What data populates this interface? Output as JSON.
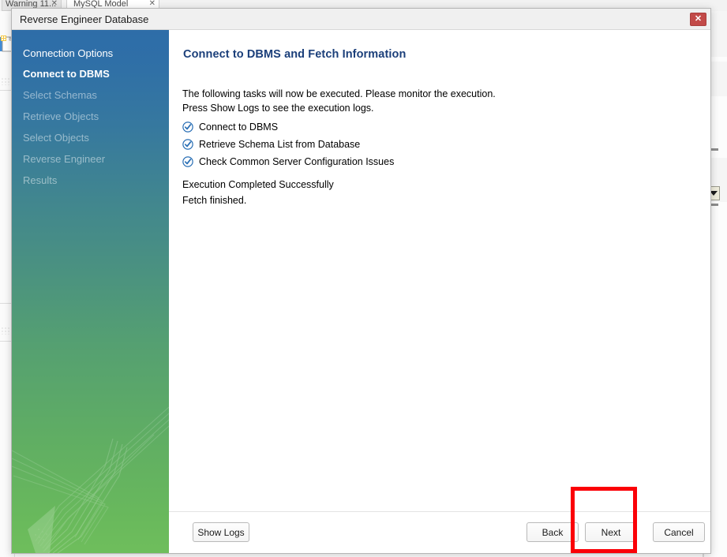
{
  "background": {
    "tabs": [
      {
        "label": "Warning  11...",
        "close": "✕",
        "state": "inactive"
      },
      {
        "label": "MySQL Model",
        "close": "✕",
        "state": "active"
      }
    ],
    "left_panel": {
      "icon": "document-icon"
    },
    "right_panel": {
      "scroll_down_icon": "scroll-down-arrow-icon"
    }
  },
  "dialog": {
    "title": "Reverse Engineer Database",
    "close_label": "✕",
    "sidebar": {
      "items": [
        {
          "label": "Connection Options",
          "state": "done"
        },
        {
          "label": "Connect to DBMS",
          "state": "active"
        },
        {
          "label": "Select Schemas",
          "state": "pending"
        },
        {
          "label": "Retrieve Objects",
          "state": "pending"
        },
        {
          "label": "Select Objects",
          "state": "pending"
        },
        {
          "label": "Reverse Engineer",
          "state": "pending"
        },
        {
          "label": "Results",
          "state": "pending"
        }
      ]
    },
    "content": {
      "heading": "Connect to DBMS and Fetch Information",
      "intro_line1": "The following tasks will now be executed. Please monitor the execution.",
      "intro_line2": "Press Show Logs to see the execution logs.",
      "tasks": [
        {
          "label": "Connect to DBMS",
          "icon": "check-circle-icon",
          "checked": true
        },
        {
          "label": "Retrieve Schema List from Database",
          "icon": "check-circle-icon",
          "checked": true
        },
        {
          "label": "Check Common Server Configuration Issues",
          "icon": "check-circle-icon",
          "checked": true
        }
      ],
      "status_line1": "Execution Completed Successfully",
      "status_line2": "Fetch finished."
    },
    "footer": {
      "show_logs_label": "Show Logs",
      "back_label": "Back",
      "next_label": "Next",
      "cancel_label": "Cancel"
    }
  },
  "annotation": {
    "highlight_target": "Next",
    "highlight_color": "#fb0007"
  },
  "colors": {
    "heading": "#1b3f7a",
    "check": "#2a6fb5",
    "sidebar_top": "#2e6da8",
    "sidebar_bottom": "#6fbe5c",
    "close_button": "#c24a48"
  }
}
